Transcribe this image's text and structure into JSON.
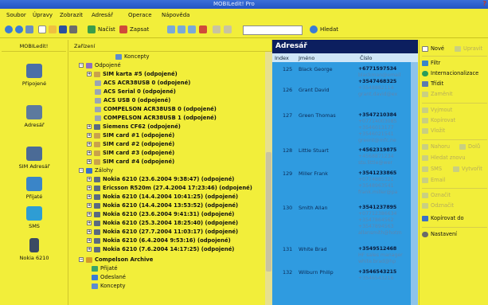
{
  "title_bar": {
    "title": "MOBILedit! Pro"
  },
  "menu": [
    "Soubor",
    "Úpravy",
    "Zobrazit",
    "Adresář",
    "Operace",
    "Nápověda"
  ],
  "toolbar": {
    "load": "Načíst",
    "write": "Zapsat",
    "search": "Hledat"
  },
  "left_panel": {
    "header": "MOBILedit!",
    "items": [
      "Připojené",
      "Adresář",
      "SIM Adresář",
      "Přijaté",
      "SMS",
      "Nokia 6210"
    ]
  },
  "tree": {
    "header": "Zařízení",
    "nodes": [
      "Koncepty",
      "Odpojené",
      "SIM karta #5 (odpojené)",
      "ACS ACR38USB 0 (odpojené)",
      "ACS Serial 0 (odpojené)",
      "ACS USB 0 (odpojené)",
      "COMPELSON ACR38USB 0 (odpojené)",
      "COMPELSON ACR38USB 1 (odpojené)",
      "Siemens CF62 (odpojené)",
      "SIM card #1 (odpojené)",
      "SIM card #2 (odpojené)",
      "SIM card #3 (odpojené)",
      "SIM card #4 (odpojené)",
      "Zálohy",
      "Nokia 6210 (23.6.2004 9:38:47) (odpojené)",
      "Ericsson R520m (27.4.2004 17:23:46) (odpojené)",
      "Nokia 6210 (14.4.2004 10:41:25) (odpojené)",
      "Nokia 6210 (14.4.2004 13:53:52) (odpojené)",
      "Nokia 6210 (23.6.2004 9:41:31) (odpojené)",
      "Nokia 6210 (25.3.2004 18:25:40) (odpojené)",
      "Nokia 6210 (27.7.2004 11:03:17) (odpojené)",
      "Nokia 6210 (6.4.2004 9:53:16) (odpojené)",
      "Nokia 6210 (7.6.2004 14:17:25) (odpojené)",
      "Compelson Archive",
      "Přijaté",
      "Odeslané",
      "Koncepty"
    ]
  },
  "contacts": {
    "header": "Adresář",
    "columns": [
      "Index",
      "Jméno",
      "Číslo"
    ],
    "rows": [
      {
        "index": "125",
        "name": "Black George",
        "numbers": [
          "+6771597534",
          "blackman@email",
          "+3547468325",
          "+3548882114",
          "grant.david@ex"
        ]
      },
      {
        "index": "126",
        "name": "Grant David",
        "numbers": []
      },
      {
        "index": "127",
        "name": "Green Thomas",
        "numbers": [
          "+3547210384",
          "+07714003085",
          "+3546013177",
          "+3546021541",
          "greent@mfc.ne"
        ]
      },
      {
        "index": "128",
        "name": "Little Stuart",
        "numbers": [
          "+4562319875",
          "+4568871234",
          "stu.little@wer"
        ]
      },
      {
        "index": "129",
        "name": "Miller Frank",
        "numbers": [
          "+3541233865",
          "+0774885321",
          "+3548963541",
          "frank.miller@pa"
        ]
      },
      {
        "index": "130",
        "name": "Smith Allan",
        "numbers": [
          "+3541237895",
          "+07712386634",
          "+3547864562",
          "+3547894563",
          "allansmith@hotm"
        ]
      },
      {
        "index": "131",
        "name": "White Brad",
        "numbers": [
          "+3549512468",
          "HF sales manager",
          "white.brad@hp"
        ]
      },
      {
        "index": "132",
        "name": "Wilburn Philip",
        "numbers": [
          "+3546543215",
          "+3546543216"
        ]
      }
    ]
  },
  "actions": {
    "items": [
      "Nové",
      "Upravit",
      "Filtr",
      "Internacionalizace",
      "Třídit",
      "Zaměnit",
      "Vyjmout",
      "Kopírovat",
      "Vložit",
      "Nahoru",
      "Dolů",
      "Hledat znovu",
      "SMS",
      "Vytvořit",
      "Email",
      "Označit",
      "Odznačit",
      "Kopírovat do",
      "Nastavení"
    ]
  }
}
